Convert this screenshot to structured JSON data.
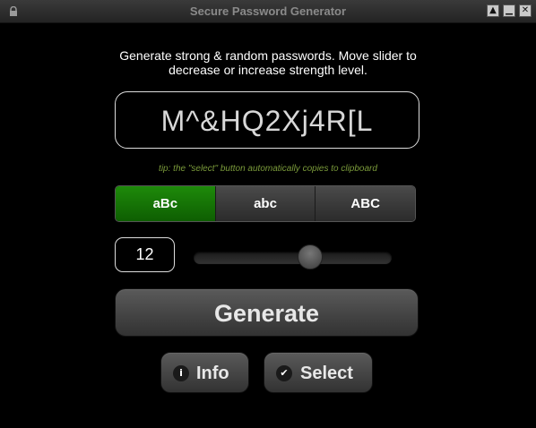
{
  "window": {
    "title": "Secure Password Generator",
    "controls": {
      "minimize": "▁",
      "restore": "▁",
      "close": "✕"
    }
  },
  "description": "Generate strong & random passwords. Move slider to decrease or increase strength level.",
  "password": "M^&HQ2Xj4R[L",
  "tip": "tip: the \"select\" button automatically copies to clipboard",
  "case_options": [
    {
      "label": "aBc",
      "active": true
    },
    {
      "label": "abc",
      "active": false
    },
    {
      "label": "ABC",
      "active": false
    }
  ],
  "length": {
    "value": "12",
    "slider_level": 0.6
  },
  "buttons": {
    "generate": "Generate",
    "info": "Info",
    "info_icon": "i",
    "select": "Select",
    "select_icon": "✔"
  },
  "colors": {
    "active_case": "#0e6a03",
    "tip_text": "#7a9a3a",
    "background": "#000000"
  }
}
